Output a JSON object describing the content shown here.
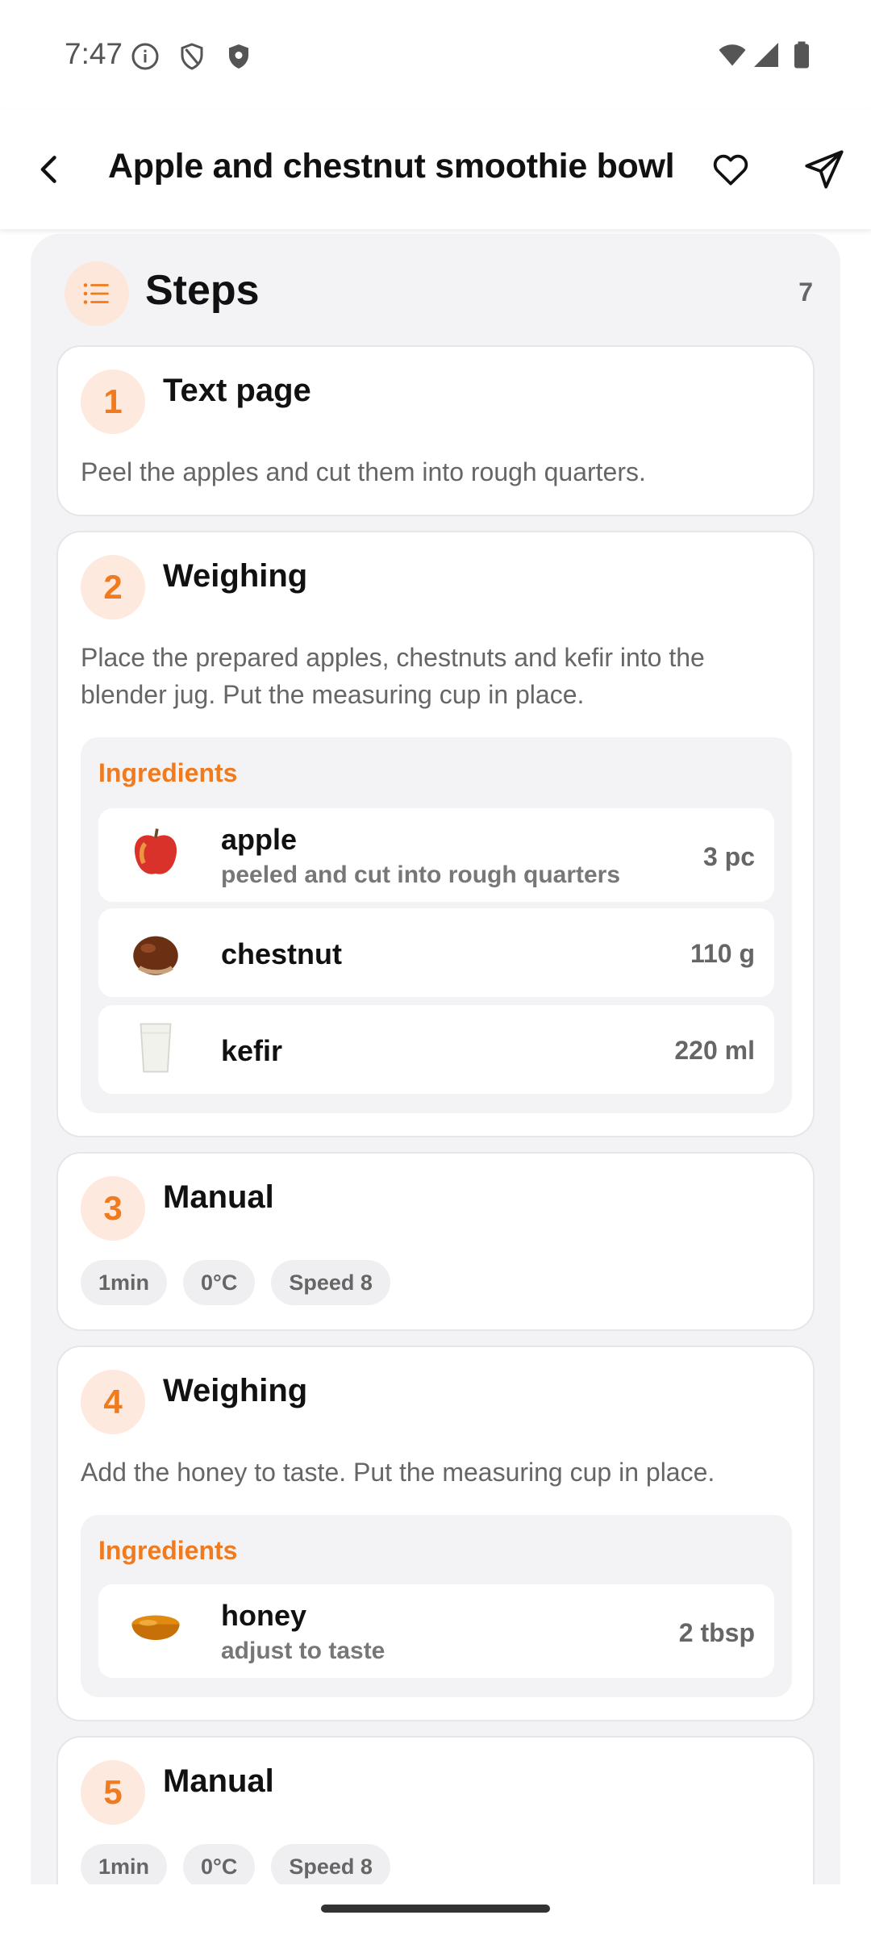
{
  "status_bar": {
    "time": "7:47",
    "icons_left": [
      "info-circle-icon",
      "shield-outline-icon",
      "shield-filled-icon"
    ],
    "icons_right": [
      "wifi-icon",
      "signal-icon",
      "battery-icon"
    ]
  },
  "app_bar": {
    "title": "Apple and chestnut smoothie bowl",
    "back_icon": "back-arrow-icon",
    "favorite_icon": "heart-outline-icon",
    "share_icon": "send-icon"
  },
  "steps": {
    "header_title": "Steps",
    "header_icon": "list-icon",
    "count": "7",
    "accent_color": "#f07a1e",
    "items": [
      {
        "number": "1",
        "title": "Text page",
        "description": "Peel the apples and cut them into rough quarters."
      },
      {
        "number": "2",
        "title": "Weighing",
        "description": "Place the prepared apples, chestnuts and kefir into the blender jug. Put the measuring cup in place.",
        "ingredients_heading": "Ingredients",
        "ingredients": [
          {
            "name": "apple",
            "note": "peeled and cut into rough quarters",
            "quantity": "3 pc",
            "icon": "apple-image"
          },
          {
            "name": "chestnut",
            "note": "",
            "quantity": "110 g",
            "icon": "chestnut-image"
          },
          {
            "name": "kefir",
            "note": "",
            "quantity": "220 ml",
            "icon": "kefir-glass-image"
          }
        ]
      },
      {
        "number": "3",
        "title": "Manual",
        "chips": [
          "1min",
          "0°C",
          "Speed 8"
        ]
      },
      {
        "number": "4",
        "title": "Weighing",
        "description": "Add the honey to taste. Put the measuring cup in place.",
        "ingredients_heading": "Ingredients",
        "ingredients": [
          {
            "name": "honey",
            "note": "adjust to taste",
            "quantity": "2 tbsp",
            "icon": "honey-bowl-image"
          }
        ]
      },
      {
        "number": "5",
        "title": "Manual",
        "chips": [
          "1min",
          "0°C",
          "Speed 8"
        ]
      }
    ]
  }
}
